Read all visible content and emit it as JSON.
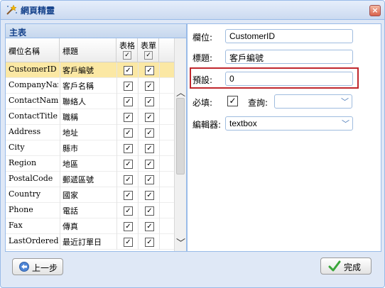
{
  "window": {
    "title": "網頁精靈",
    "close_label": "×"
  },
  "left_panel": {
    "title": "主表",
    "columns": {
      "field": "欄位名稱",
      "title": "標題",
      "grid": "表格",
      "form": "表單"
    },
    "rows": [
      {
        "field": "CustomerID",
        "title": "客戶編號",
        "grid": true,
        "form": true,
        "selected": true
      },
      {
        "field": "CompanyName",
        "title": "客戶名稱",
        "grid": true,
        "form": true
      },
      {
        "field": "ContactName",
        "title": "聯絡人",
        "grid": true,
        "form": true
      },
      {
        "field": "ContactTitle",
        "title": "職稱",
        "grid": true,
        "form": true
      },
      {
        "field": "Address",
        "title": "地址",
        "grid": true,
        "form": true
      },
      {
        "field": "City",
        "title": "縣市",
        "grid": true,
        "form": true
      },
      {
        "field": "Region",
        "title": "地區",
        "grid": true,
        "form": true
      },
      {
        "field": "PostalCode",
        "title": "郵遞區號",
        "grid": true,
        "form": true
      },
      {
        "field": "Country",
        "title": "國家",
        "grid": true,
        "form": true
      },
      {
        "field": "Phone",
        "title": "電話",
        "grid": true,
        "form": true
      },
      {
        "field": "Fax",
        "title": "傳真",
        "grid": true,
        "form": true
      },
      {
        "field": "LastOrderedDate",
        "title": "最近訂單日",
        "grid": true,
        "form": true
      }
    ]
  },
  "right_panel": {
    "field_label": "欄位:",
    "field_value": "CustomerID",
    "title_label": "標題:",
    "title_value": "客戶編號",
    "default_label": "預設:",
    "default_value": "0",
    "required_label": "必填:",
    "required_checked": true,
    "query_label": "查詢:",
    "query_value": "",
    "editor_label": "編輯器:",
    "editor_value": "textbox"
  },
  "footer": {
    "prev_label": "上一步",
    "done_label": "完成"
  },
  "colors": {
    "accent": "#15428b",
    "border": "#99bbe8",
    "selected_row": "#fbe8a4",
    "highlight": "#c0272d"
  }
}
